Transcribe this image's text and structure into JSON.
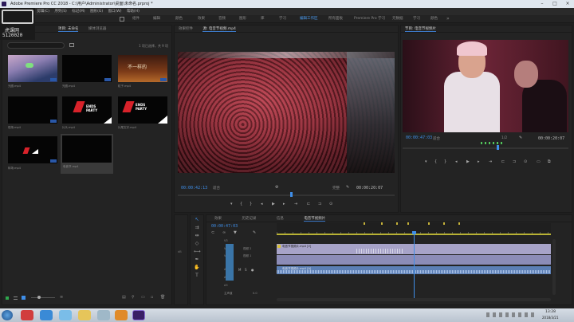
{
  "window": {
    "title": "Adobe Premiere Pro CC 2018 - C:\\用户\\Administrator\\桌面\\未命名.prproj *"
  },
  "menu": [
    "文件(F)",
    "编辑(E)",
    "剪辑(C)",
    "序列(S)",
    "标记(M)",
    "图形(G)",
    "窗口(W)",
    "帮助(H)"
  ],
  "workspaces": [
    {
      "label": "组件",
      "active": false
    },
    {
      "label": "编辑",
      "active": false
    },
    {
      "label": "颜色",
      "active": false
    },
    {
      "label": "效果",
      "active": false
    },
    {
      "label": "音频",
      "active": false
    },
    {
      "label": "图形",
      "active": false
    },
    {
      "label": "库",
      "active": false
    },
    {
      "label": "学习",
      "active": false
    },
    {
      "label": "编辑工作区",
      "active": true
    },
    {
      "label": "所有面板",
      "active": false
    },
    {
      "label": "Premiere Pro 学习",
      "active": false
    },
    {
      "label": "元数据",
      "active": false
    },
    {
      "label": "学习",
      "active": false
    },
    {
      "label": "颜色",
      "active": false
    }
  ],
  "watermark": {
    "brand": "虎课网",
    "id": "5120020"
  },
  "project": {
    "tabs": [
      "项目: 未命名",
      "媒体浏览器"
    ],
    "path": "未命名.prproj",
    "search_placeholder": "",
    "item_count": "1 项已选择，共 9 项",
    "items": [
      {
        "label": "光圈.mp4",
        "duration": ""
      },
      {
        "label": "光圈.mp4",
        "duration": ""
      },
      {
        "label": "粒子.mp4",
        "duration": ""
      },
      {
        "label": "现场.mp4",
        "duration": ""
      },
      {
        "label": "片头.mp4",
        "duration": ""
      },
      {
        "label": "片尾文字.mp4",
        "duration": ""
      },
      {
        "label": "转场.mp4",
        "duration": ""
      },
      {
        "label": "电音节.mp4",
        "duration": ""
      }
    ],
    "thumb_text": {
      "party": "ENDS PARTY",
      "sign": "不一样的"
    }
  },
  "source_monitor": {
    "tabs": [
      "效果控件",
      "源: 电音节视频.mp4"
    ],
    "timecode": "00:00:42:13",
    "fit": "适合",
    "quality": "完整",
    "duration": "00:00:20:07"
  },
  "program_monitor": {
    "tab": "节目: 电音节视频片",
    "timecode": "00:00:47:03",
    "fit": "适合",
    "quality": "1/2",
    "duration": "00:00:20:07"
  },
  "timeline": {
    "tabs": [
      "效果",
      "历史记录",
      "信息",
      "电音节视频片"
    ],
    "timecode": "00:00:47:03",
    "tracks": [
      {
        "name": "V3",
        "label": ""
      },
      {
        "name": "V2",
        "label": "视频 2"
      },
      {
        "name": "V1",
        "label": "视频 1"
      },
      {
        "name": "A1",
        "label": ""
      },
      {
        "name": "A2",
        "label": ""
      },
      {
        "name": "A3",
        "label": ""
      },
      {
        "name": "主声道",
        "label": "0.0"
      }
    ],
    "clip_video": "电音节视频片.mp4 [V]",
    "clip_audio": "电音节视频片.mp4 [A]"
  },
  "taskbar": {
    "time": "13:28",
    "date": "2018/3/21"
  },
  "colors": {
    "accent": "#3f8ee8",
    "panel": "#232323",
    "clip_video": "#a7a3c8",
    "clip_audio": "#5c7fb5"
  }
}
